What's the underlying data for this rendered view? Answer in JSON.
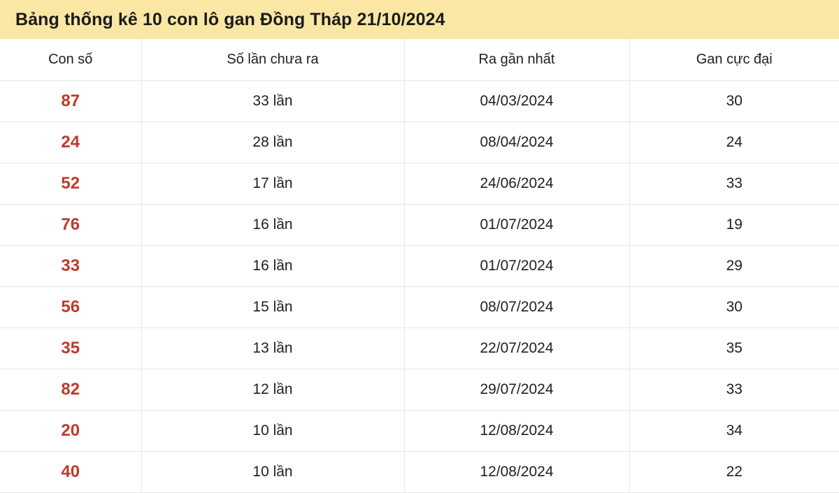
{
  "header": {
    "title": "Bảng thống kê 10 con lô gan Đồng Tháp 21/10/2024",
    "banner_color": "#fae7a3",
    "title_color": "#1b1b1b"
  },
  "table": {
    "accent_number_color": "#c0392b",
    "grid_color": "#e6e6e6",
    "columns": [
      {
        "key": "con_so",
        "label": "Con số"
      },
      {
        "key": "so_lan_chua_ra",
        "label": "Số lần chưa ra"
      },
      {
        "key": "ra_gan_nhat",
        "label": "Ra gần nhất"
      },
      {
        "key": "gan_cuc_dai",
        "label": "Gan cực đại"
      }
    ],
    "rows": [
      {
        "con_so": "87",
        "so_lan_chua_ra": "33 lần",
        "ra_gan_nhat": "04/03/2024",
        "gan_cuc_dai": "30"
      },
      {
        "con_so": "24",
        "so_lan_chua_ra": "28 lần",
        "ra_gan_nhat": "08/04/2024",
        "gan_cuc_dai": "24"
      },
      {
        "con_so": "52",
        "so_lan_chua_ra": "17 lần",
        "ra_gan_nhat": "24/06/2024",
        "gan_cuc_dai": "33"
      },
      {
        "con_so": "76",
        "so_lan_chua_ra": "16 lần",
        "ra_gan_nhat": "01/07/2024",
        "gan_cuc_dai": "19"
      },
      {
        "con_so": "33",
        "so_lan_chua_ra": "16 lần",
        "ra_gan_nhat": "01/07/2024",
        "gan_cuc_dai": "29"
      },
      {
        "con_so": "56",
        "so_lan_chua_ra": "15 lần",
        "ra_gan_nhat": "08/07/2024",
        "gan_cuc_dai": "30"
      },
      {
        "con_so": "35",
        "so_lan_chua_ra": "13 lần",
        "ra_gan_nhat": "22/07/2024",
        "gan_cuc_dai": "35"
      },
      {
        "con_so": "82",
        "so_lan_chua_ra": "12 lần",
        "ra_gan_nhat": "29/07/2024",
        "gan_cuc_dai": "33"
      },
      {
        "con_so": "20",
        "so_lan_chua_ra": "10 lần",
        "ra_gan_nhat": "12/08/2024",
        "gan_cuc_dai": "34"
      },
      {
        "con_so": "40",
        "so_lan_chua_ra": "10 lần",
        "ra_gan_nhat": "12/08/2024",
        "gan_cuc_dai": "22"
      }
    ]
  }
}
